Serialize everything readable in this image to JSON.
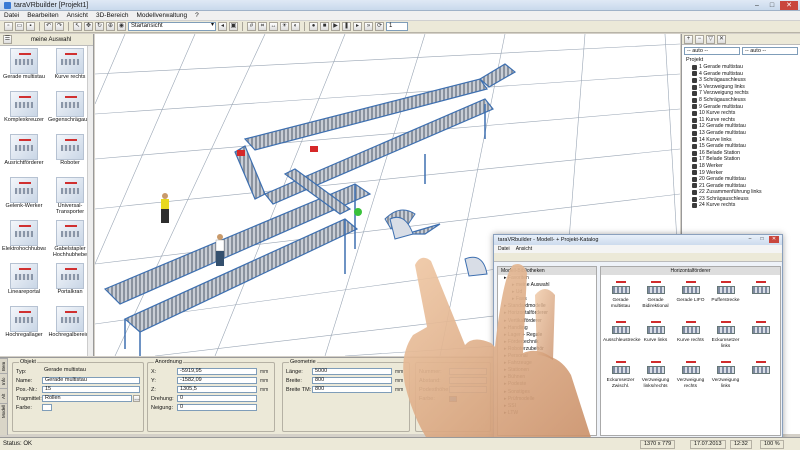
{
  "window": {
    "title": "taraVRbuilder [Projekt1]",
    "buttons": [
      "–",
      "□",
      "✕"
    ]
  },
  "menu": [
    "Datei",
    "Bearbeiten",
    "Ansicht",
    "3D-Bereich",
    "Modellverwaltung",
    "?"
  ],
  "toolbar": {
    "view_select": "Startansicht",
    "number_select": "1"
  },
  "left_panel": {
    "header": "meine Auswahl",
    "items": [
      "Gerade multistau",
      "Kurve rechts",
      "Komplexkreuzer",
      "Gegenschrägauslauf",
      "Ausrichtförderer",
      "Roboter",
      "Gelenk-Werker",
      "Universal-Transporter",
      "Elektrohochhubwagen",
      "Gabelstapler Hochhubhebe",
      "Lineareportal",
      "Portalkran",
      "Hochregallager",
      "Hochregalbereich"
    ]
  },
  "right_panel": {
    "select_left": "-- auto --",
    "select_right": "-- auto --",
    "root": "Projekt",
    "items": [
      "1 Gerade multistau",
      "4 Gerade multistau",
      "3 Schrägauschleuss",
      "5 Verzweigung links",
      "7 Verzweigung rechts",
      "8 Schrägauschleuss",
      "9 Gerade multistau",
      "10 Kurve rechts",
      "11 Kurve rechts",
      "12 Gerade multistau",
      "13 Gerade multistau",
      "14 Kurve links",
      "15 Gerade multistau",
      "16 Belade Station",
      "17 Belade Station",
      "18 Werker",
      "19 Werker",
      "20 Gerade multistau",
      "21 Gerade multistau",
      "22 Zusammenführung links",
      "23 Schrägauschleuss",
      "24 Kurve rechts"
    ]
  },
  "properties": {
    "side_tabs": [
      "Bem",
      "Info",
      "Alt",
      "Modell"
    ],
    "objekt": {
      "title": "Objekt",
      "typ_label": "Typ:",
      "typ": "Gerade multistau",
      "name_label": "Name:",
      "name": "Gerade multistau",
      "pos_label": "Pos.-Nr.:",
      "pos": "15",
      "tragmittel_label": "Tragmittel:",
      "tragmittel": "Rollen",
      "farbe_label": "Farbe:"
    },
    "anordnung": {
      "title": "Anordnung",
      "x_label": "X:",
      "x": "-5919,95",
      "y_label": "Y:",
      "y": "-1582,09",
      "z_label": "Z:",
      "z": "1305,5",
      "drehung_label": "Drehung:",
      "drehung": "0",
      "neigung_label": "Neigung:",
      "neigung": "0",
      "unit": "mm"
    },
    "geometrie": {
      "title": "Geometrie",
      "laenge_label": "Länge:",
      "laenge": "5000",
      "breite_label": "Breite:",
      "breite": "800",
      "breite_tm_label": "Breite TM:",
      "breite_tm": "800",
      "unit": "mm"
    },
    "extra": {
      "nummer_label": "Nummer:",
      "abstand_label": "Abstand:",
      "podesthoehe_label": "Podesthöhe:",
      "farbe_label": "Farbe:"
    }
  },
  "catalog": {
    "title": "taraVRbuilder - Modell- + Projekt-Katalog",
    "menu": [
      "Datei",
      "Ansicht"
    ],
    "tree_header": "Modell-Bibliotheken",
    "tree": [
      "Favoriten",
      "meine Auswahl",
      "Ud",
      "Favs",
      "Standardmodelle",
      "Horizontalförderer",
      "Vertikalförderer",
      "Handling",
      "Lager + Regale",
      "Fördertechnik",
      "Roboterzubehör",
      "Personal",
      "Fahrzeuge",
      "Stationen",
      "Bühnen",
      "Podeste",
      "Sonstiges",
      "Prüfmodelle",
      "SSI",
      "LTW"
    ],
    "grid_header": "Horizontalförderer",
    "items": [
      "Gerade multistau",
      "Gerade Bidirektional",
      "Gerade LIFO",
      "Pufferstrecke",
      "",
      "Ausschleustrecke",
      "Kurve links",
      "Kurve rechts",
      "Eckumsetzer links",
      "",
      "Eckumsetzer Zwischl.",
      "Verzweigung links/rechts",
      "Verzweigung rechts",
      "Verzweigung links",
      ""
    ]
  },
  "status": {
    "left": "Status: OK",
    "size": "1370 x 779",
    "date": "17.07.2013",
    "time": "12:32",
    "zoom": "100 %"
  }
}
